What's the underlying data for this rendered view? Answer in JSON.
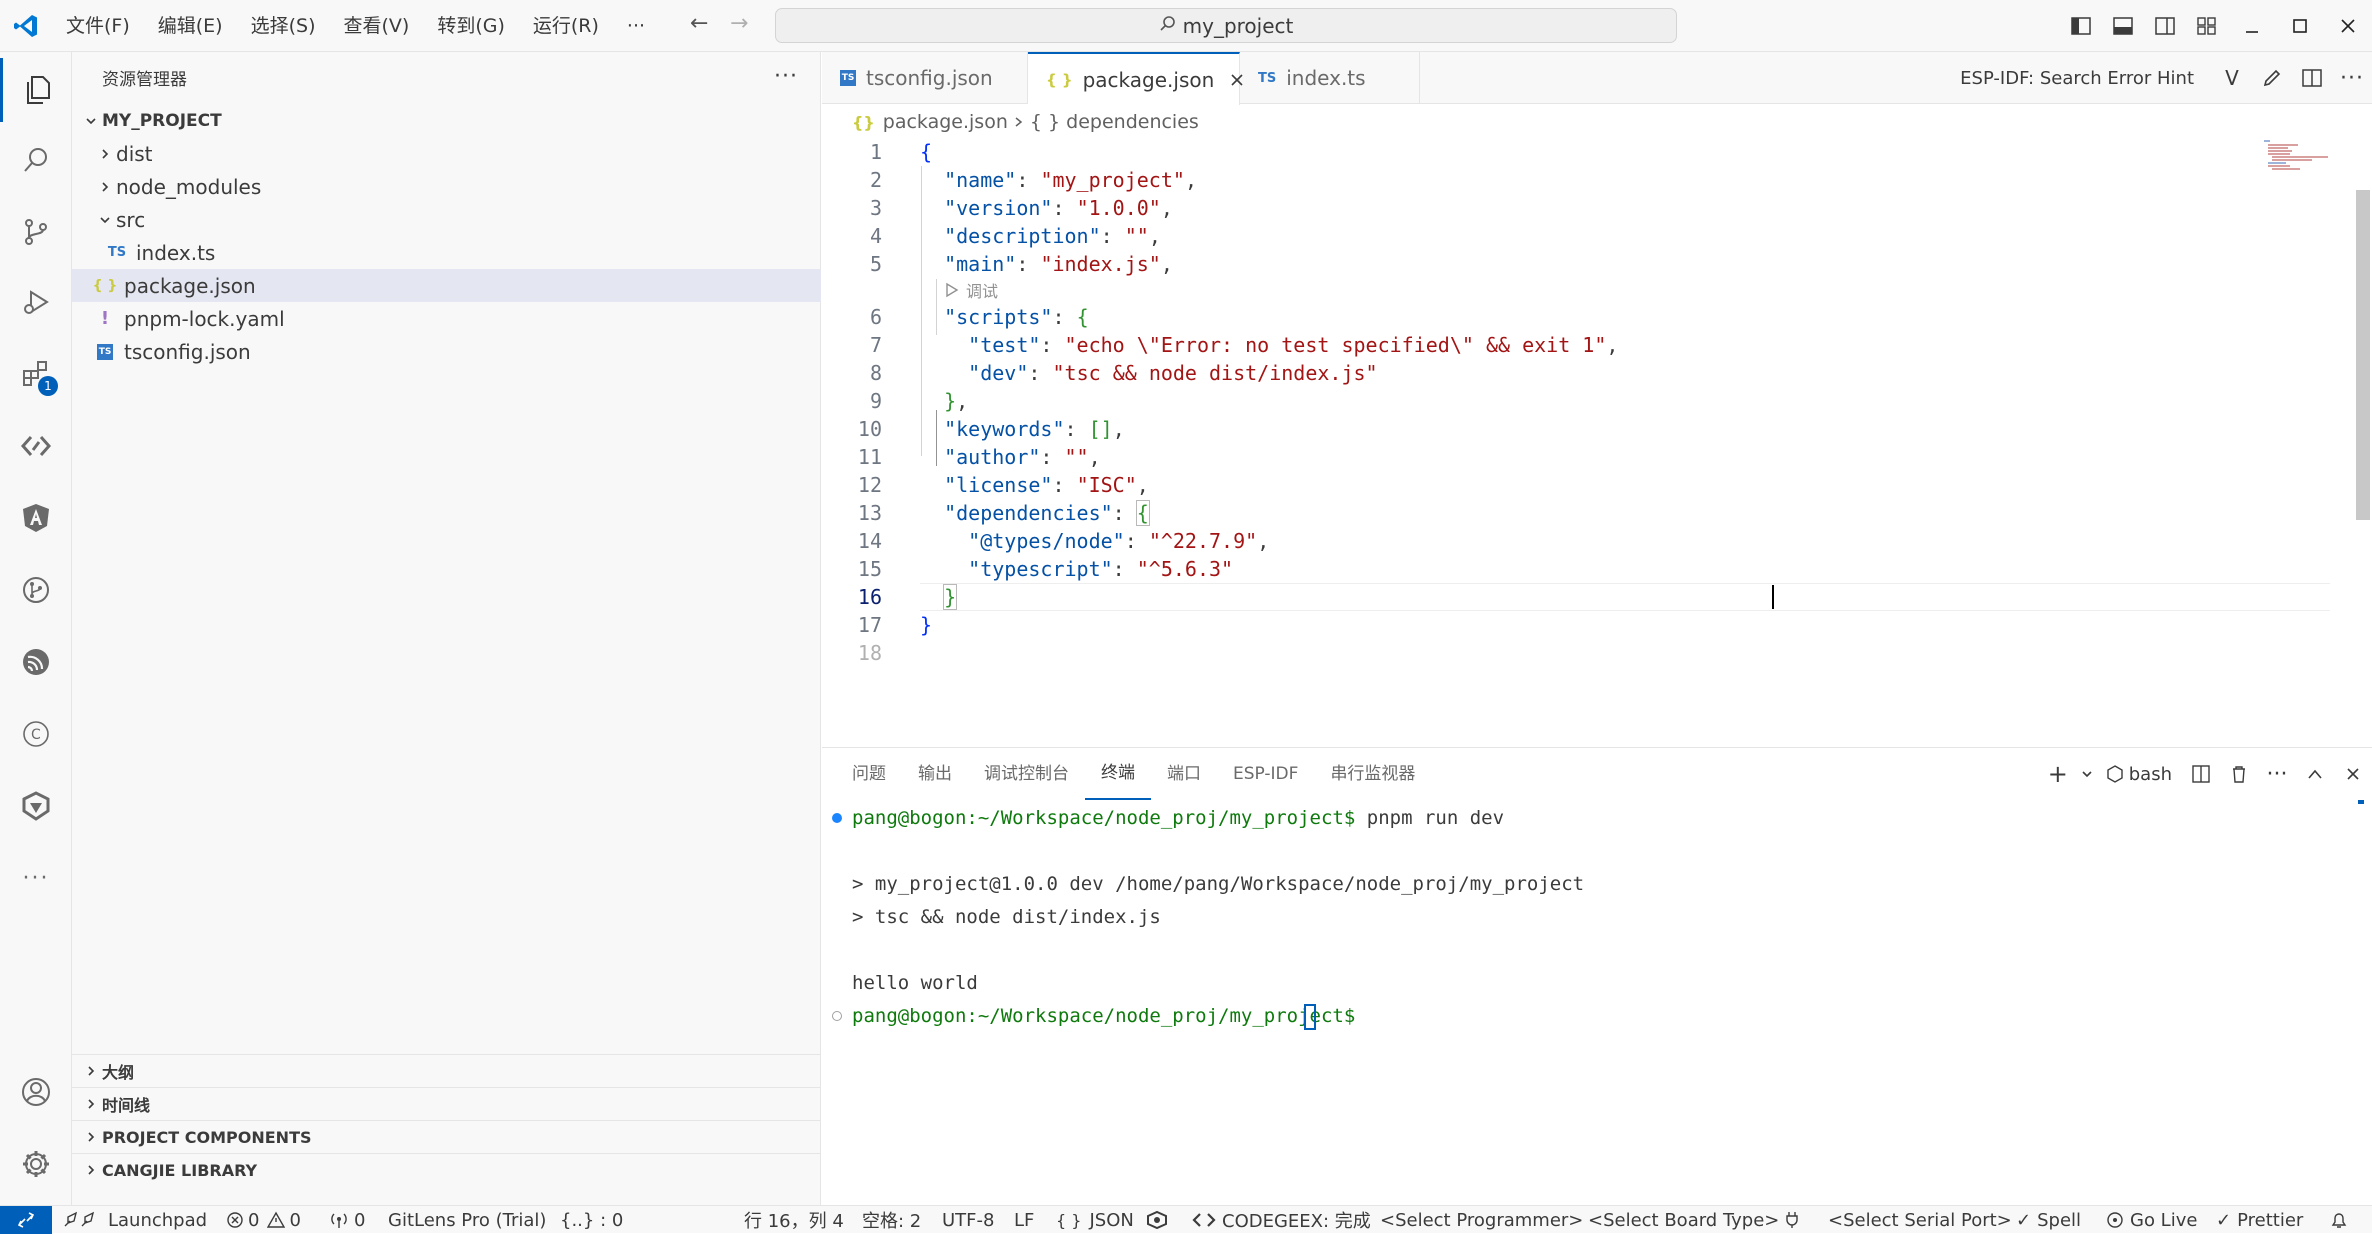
{
  "window": {
    "menus": [
      "文件(F)",
      "编辑(E)",
      "选择(S)",
      "查看(V)",
      "转到(G)",
      "运行(R)"
    ],
    "more_menu": "···",
    "search_text": "my_project"
  },
  "activity": {
    "extensions_badge": "1"
  },
  "explorer": {
    "title": "资源管理器",
    "more": "···",
    "project": "MY_PROJECT",
    "items": [
      {
        "label": "dist",
        "kind": "folder"
      },
      {
        "label": "node_modules",
        "kind": "folder"
      },
      {
        "label": "src",
        "kind": "folder-open"
      },
      {
        "label": "index.ts",
        "kind": "ts",
        "icon_text": "TS"
      },
      {
        "label": "package.json",
        "kind": "json",
        "icon_text": "{ }"
      },
      {
        "label": "pnpm-lock.yaml",
        "kind": "yaml",
        "icon_text": "!"
      },
      {
        "label": "tsconfig.json",
        "kind": "tsconfig",
        "icon_text": "TS"
      }
    ],
    "sections": [
      "大纲",
      "时间线",
      "PROJECT COMPONENTS",
      "CANGJIE LIBRARY"
    ]
  },
  "editor": {
    "tabs": [
      {
        "label": "tsconfig.json",
        "icon_text": "TS"
      },
      {
        "label": "package.json",
        "icon_text": "{ }"
      },
      {
        "label": "index.ts",
        "icon_text": "TS"
      }
    ],
    "active_tab": "package.json",
    "hint": "ESP-IDF: Search Error Hint",
    "breadcrumb": {
      "file": "package.json",
      "symbol": "{ } dependencies"
    },
    "codelens": "调试",
    "line_numbers": [
      "1",
      "2",
      "3",
      "4",
      "5",
      "6",
      "7",
      "8",
      "9",
      "10",
      "11",
      "12",
      "13",
      "14",
      "15",
      "16",
      "17",
      "18"
    ],
    "current_line": "16"
  },
  "panel": {
    "tabs": [
      "问题",
      "输出",
      "调试控制台",
      "终端",
      "端口",
      "ESP-IDF",
      "串行监视器"
    ],
    "active_tab": "终端",
    "shell": "bash",
    "terminal": {
      "prompt1": "pang@bogon:~/Workspace/node_proj/my_project$",
      "cmd1": " pnpm run dev",
      "out1": "> my_project@1.0.0 dev /home/pang/Workspace/node_proj/my_project",
      "out2": "> tsc && node dist/index.js",
      "out3": "hello world",
      "prompt2": "pang@bogon:~/Workspace/node_proj/my_project$"
    }
  },
  "status": {
    "launchpad": "Launchpad",
    "errors": "0",
    "warnings": "0",
    "ports": "0",
    "gitlens": "GitLens Pro (Trial)",
    "brackets": "{..} : 0",
    "position": "行 16，列 4",
    "spaces": "空格: 2",
    "encoding": "UTF-8",
    "eol": "LF",
    "language": "JSON",
    "codegeex": "CODEGEEX: 完成",
    "programmer": "<Select Programmer>",
    "board": "<Select Board Type>",
    "serial": "<Select Serial Port>",
    "spell": "Spell",
    "golive": "Go Live",
    "prettier": "Prettier"
  },
  "colors": {
    "accent": "#005fb8",
    "json_key": "#0451a5",
    "json_string": "#a31515",
    "terminal_prompt": "#0e7a0d"
  }
}
